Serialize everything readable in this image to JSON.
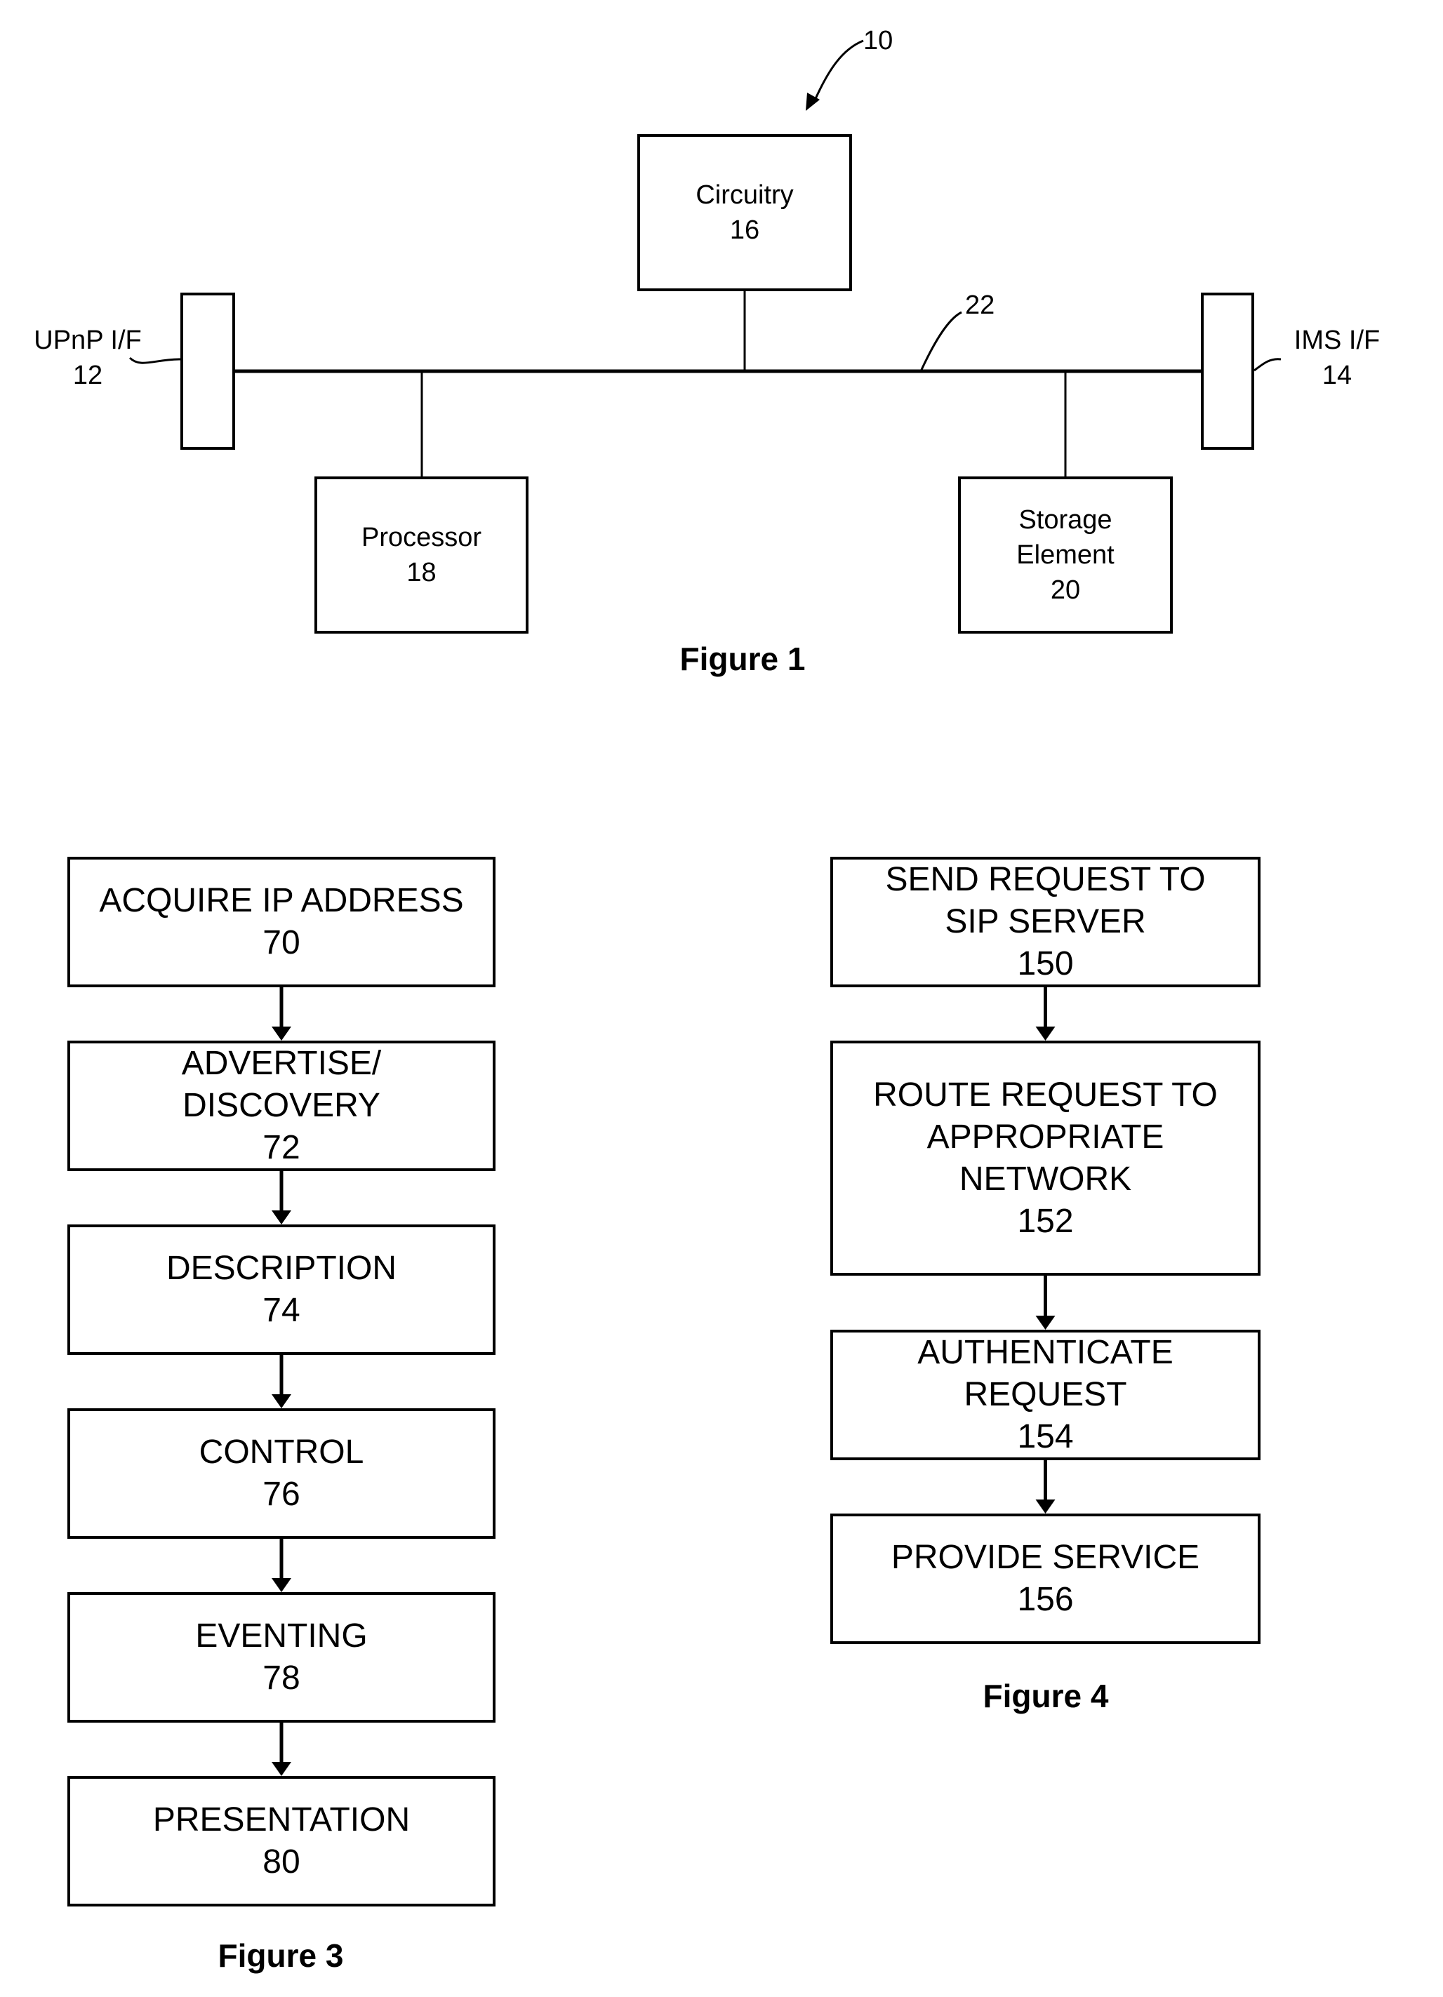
{
  "figure1": {
    "caption": "Figure 1",
    "ref_device": "10",
    "ref_bus": "22",
    "circuitry": {
      "line1": "Circuitry",
      "line2": "16"
    },
    "processor": {
      "line1": "Processor",
      "line2": "18"
    },
    "storage": {
      "line1": "Storage",
      "line2": "Element",
      "line3": "20"
    },
    "upnp": {
      "line1": "UPnP I/F",
      "line2": "12"
    },
    "ims": {
      "line1": "IMS I/F",
      "line2": "14"
    }
  },
  "figure3": {
    "caption": "Figure 3",
    "steps": [
      {
        "lines": [
          "ACQUIRE IP ADDRESS",
          "70"
        ]
      },
      {
        "lines": [
          "ADVERTISE/",
          "DISCOVERY",
          "72"
        ]
      },
      {
        "lines": [
          "DESCRIPTION",
          "74"
        ]
      },
      {
        "lines": [
          "CONTROL",
          "76"
        ]
      },
      {
        "lines": [
          "EVENTING",
          "78"
        ]
      },
      {
        "lines": [
          "PRESENTATION",
          "80"
        ]
      }
    ]
  },
  "figure4": {
    "caption": "Figure 4",
    "steps": [
      {
        "lines": [
          "SEND REQUEST TO",
          "SIP SERVER",
          "150"
        ]
      },
      {
        "lines": [
          "ROUTE REQUEST TO",
          "APPROPRIATE",
          "NETWORK",
          "152"
        ]
      },
      {
        "lines": [
          "AUTHENTICATE",
          "REQUEST",
          "154"
        ]
      },
      {
        "lines": [
          "PROVIDE SERVICE",
          "156"
        ]
      }
    ]
  }
}
